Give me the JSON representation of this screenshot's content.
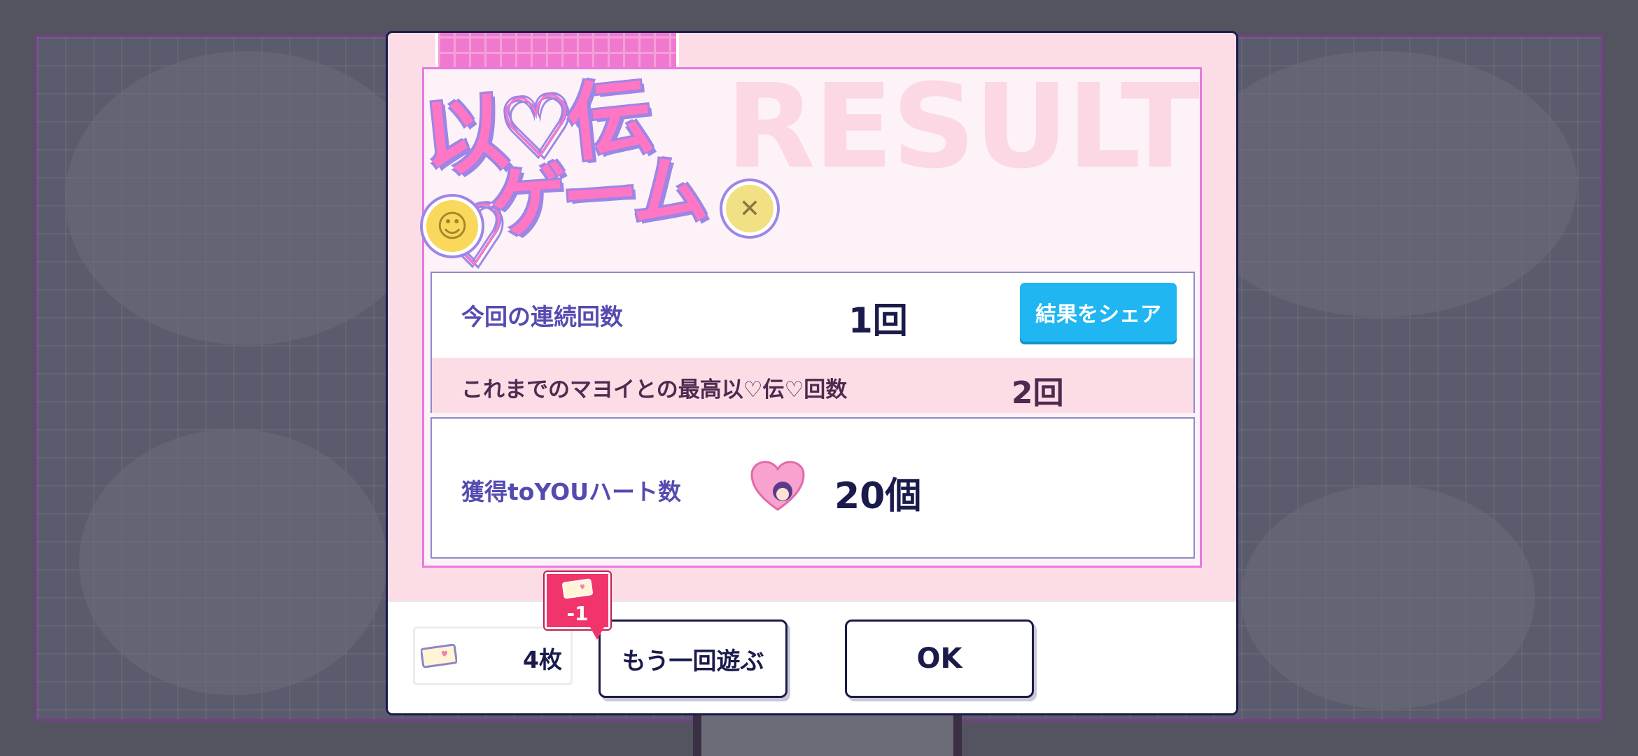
{
  "background": {
    "frame_color": "#7d3b8e"
  },
  "logo": {
    "line1": "以♡伝♡",
    "line2": "ゲーム"
  },
  "watermark": "RESULT",
  "stats": {
    "streak_label": "今回の連続回数",
    "streak_value": "1回",
    "share_label": "結果をシェア",
    "best_label": "これまでのマヨイとの最高以♡伝♡回数",
    "best_value": "2回"
  },
  "hearts": {
    "label": "獲得toYOUハート数",
    "icon": "heart-character-icon",
    "value": "20個"
  },
  "footer": {
    "ticket_icon": "ticket-icon",
    "ticket_count": "4枚",
    "cost_badge": "-1",
    "replay_label": "もう一回遊ぶ",
    "ok_label": "OK"
  },
  "colors": {
    "accent_blue": "#1fb6f2",
    "pink": "#fcdde6",
    "navy": "#1a1b4b",
    "badge": "#f2346c"
  }
}
